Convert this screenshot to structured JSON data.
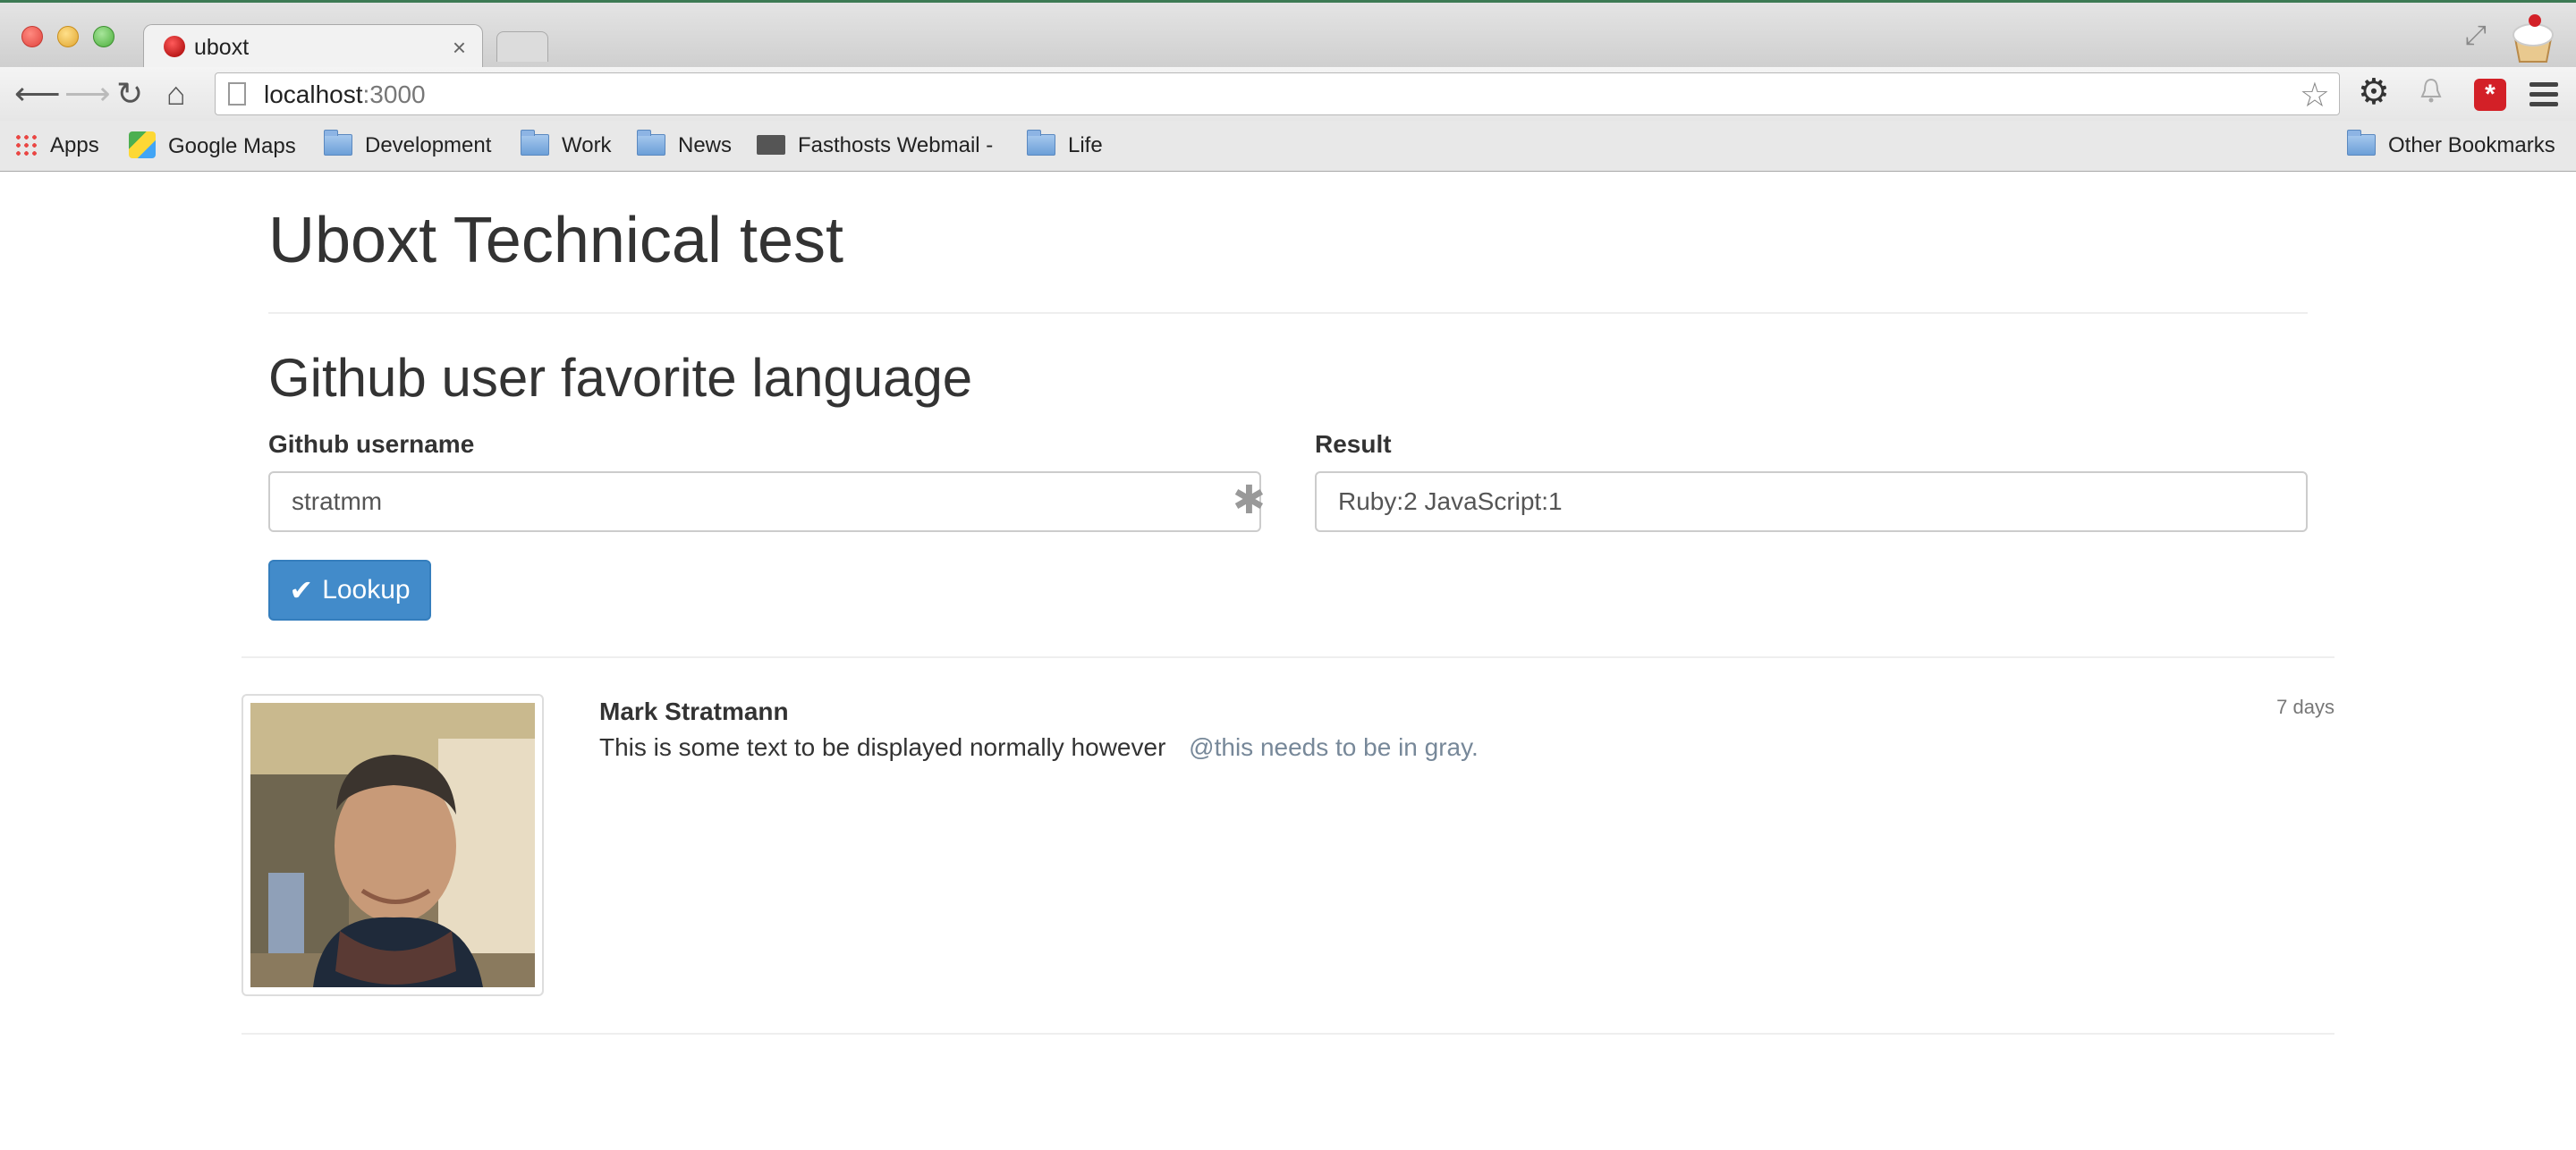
{
  "browser": {
    "tab_title": "uboxt",
    "tab_close": "×",
    "url_host": "localhost",
    "url_port": ":3000",
    "bookmarks": [
      {
        "label": "Apps",
        "icon": "apps-grid-icon"
      },
      {
        "label": "Google Maps",
        "icon": "maps-icon"
      },
      {
        "label": "Development",
        "icon": "folder-icon"
      },
      {
        "label": "Work",
        "icon": "folder-icon"
      },
      {
        "label": "News",
        "icon": "folder-icon"
      },
      {
        "label": "Fasthosts Webmail -",
        "icon": "mail-icon"
      },
      {
        "label": "Life",
        "icon": "folder-icon"
      }
    ],
    "other_bookmarks": "Other Bookmarks"
  },
  "page": {
    "title": "Uboxt Technical test",
    "section_title": "Github user favorite language",
    "form": {
      "username_label": "Github username",
      "username_value": "stratmm",
      "result_label": "Result",
      "result_value": "Ruby:2 JavaScript:1",
      "lookup_label": "Lookup"
    },
    "post": {
      "user_name": "Mark Stratmann",
      "time": "7 days",
      "text": "This is some text to be displayed normally however",
      "mention": "@this needs to be in gray."
    }
  },
  "colors": {
    "primary_button": "#428bca",
    "mention_gray": "#778899"
  }
}
